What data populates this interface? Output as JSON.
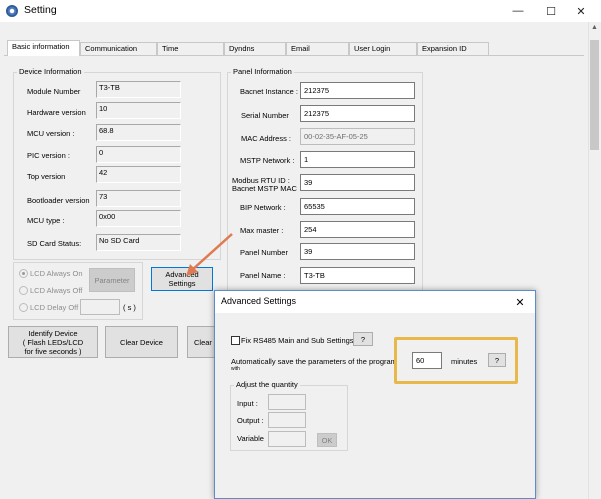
{
  "window": {
    "title": "Setting",
    "minimize": "—",
    "maximize": "☐",
    "close": "✕"
  },
  "tabs": [
    {
      "label": "Basic information"
    },
    {
      "label": "Communication"
    },
    {
      "label": "Time"
    },
    {
      "label": "Dyndns"
    },
    {
      "label": "Email"
    },
    {
      "label": "User Login"
    },
    {
      "label": "Expansion ID"
    }
  ],
  "device_info": {
    "title": "Device Information",
    "rows": [
      {
        "label": "Module Number",
        "value": "T3-TB"
      },
      {
        "label": "Hardware version",
        "value": "10"
      },
      {
        "label": "MCU version :",
        "value": "68.8"
      },
      {
        "label": "PIC version :",
        "value": "0"
      },
      {
        "label": "Top version",
        "value": "42"
      },
      {
        "label": "Bootloader version",
        "value": "73"
      },
      {
        "label": "MCU type :",
        "value": "0x00"
      },
      {
        "label": "SD Card Status:",
        "value": "No SD Card"
      }
    ]
  },
  "lcd": {
    "always_on": "LCD Always On",
    "always_off": "LCD Always Off",
    "delay_off": "LCD Delay Off",
    "delay_unit": "( s )",
    "parameter_button": "Parameter"
  },
  "advanced_settings_button": "Advanced Settings",
  "panel_info": {
    "title": "Panel Information",
    "rows": [
      {
        "label": "Bacnet Instance :",
        "value": "212375"
      },
      {
        "label": "Serial Number",
        "value": "212375"
      },
      {
        "label": "MAC Address :",
        "value": "00-02-35-AF-05-25"
      },
      {
        "label": "MSTP Network :",
        "value": "1"
      },
      {
        "label": "Modbus RTU ID :",
        "label2": "Bacnet MSTP MAC",
        "value": "39"
      },
      {
        "label": "BIP Network :",
        "value": "65535"
      },
      {
        "label": "Max master :",
        "value": "254"
      },
      {
        "label": "Panel Number",
        "value": "39"
      },
      {
        "label": "Panel Name :",
        "value": "T3-TB"
      }
    ]
  },
  "bottom_buttons": {
    "identify": [
      "Identify Device",
      "( Flash LEDs/LCD",
      "for five seconds )"
    ],
    "clear_device": "Clear Device",
    "clear_s": "Clear S"
  },
  "dialog": {
    "title": "Advanced Settings",
    "close": "✕",
    "fix_rs485": "Fix RS485 Main and Sub Settings",
    "help": "?",
    "autosave_label": "Automatically save the parameters of the program",
    "autosave_wrap": "with",
    "autosave_value": "60",
    "autosave_unit": "minutes",
    "adjust_title": "Adjust the quantity",
    "input_label": "Input :",
    "output_label": "Output :",
    "variable_label": "Variable",
    "ok": "OK"
  },
  "colors": {
    "highlight": "#e8b84a",
    "arrow": "#e07a50",
    "accent": "#0078d7"
  }
}
